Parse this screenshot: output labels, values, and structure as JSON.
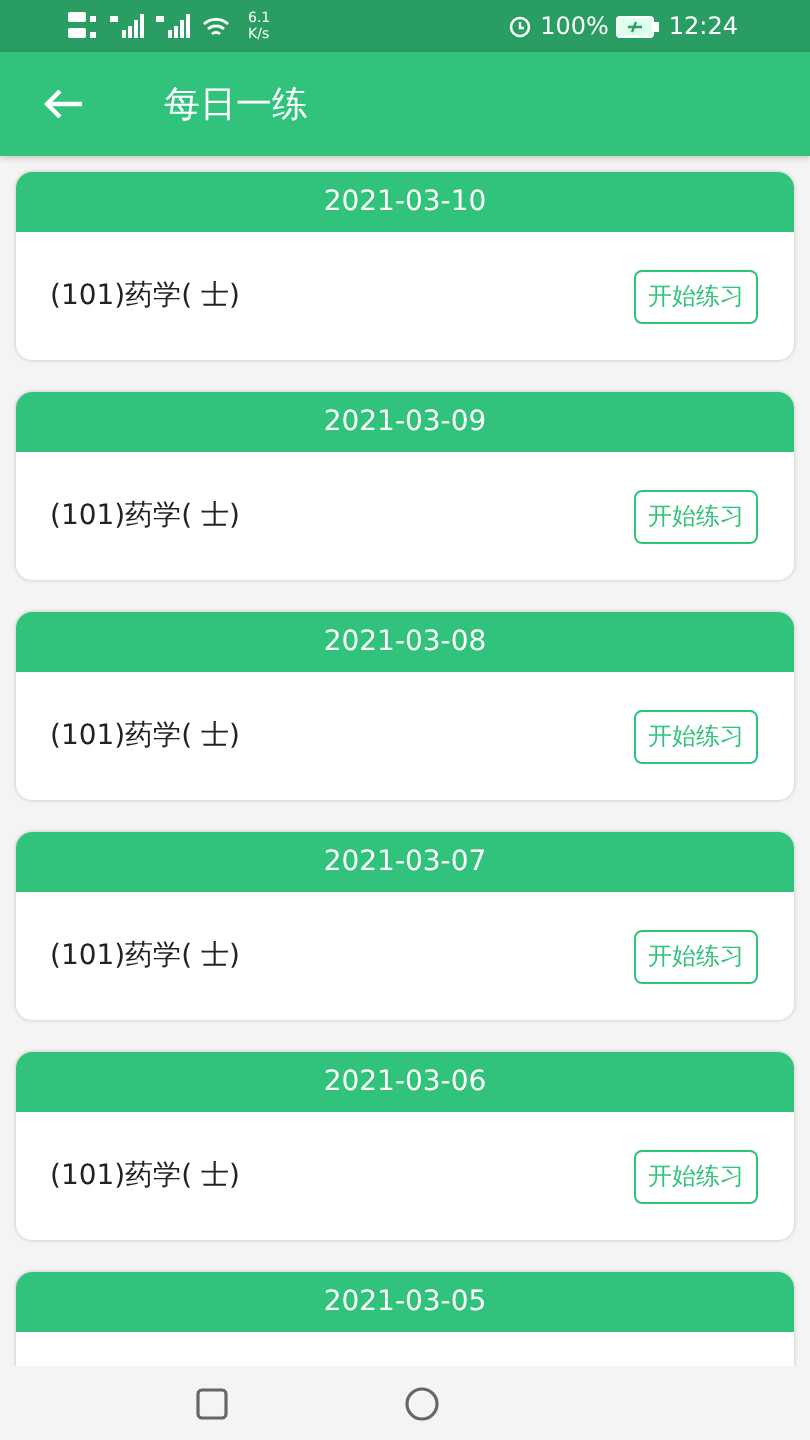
{
  "status_bar": {
    "speed_value": "6.1",
    "speed_unit": "K/s",
    "battery": "100%",
    "time": "12:24"
  },
  "app_bar": {
    "title": "每日一练"
  },
  "items": [
    {
      "date": "2021-03-10",
      "subject": "(101)药学( 士)",
      "button": "开始练习"
    },
    {
      "date": "2021-03-09",
      "subject": "(101)药学( 士)",
      "button": "开始练习"
    },
    {
      "date": "2021-03-08",
      "subject": "(101)药学( 士)",
      "button": "开始练习"
    },
    {
      "date": "2021-03-07",
      "subject": "(101)药学( 士)",
      "button": "开始练习"
    },
    {
      "date": "2021-03-06",
      "subject": "(101)药学( 士)",
      "button": "开始练习"
    },
    {
      "date": "2021-03-05"
    }
  ]
}
